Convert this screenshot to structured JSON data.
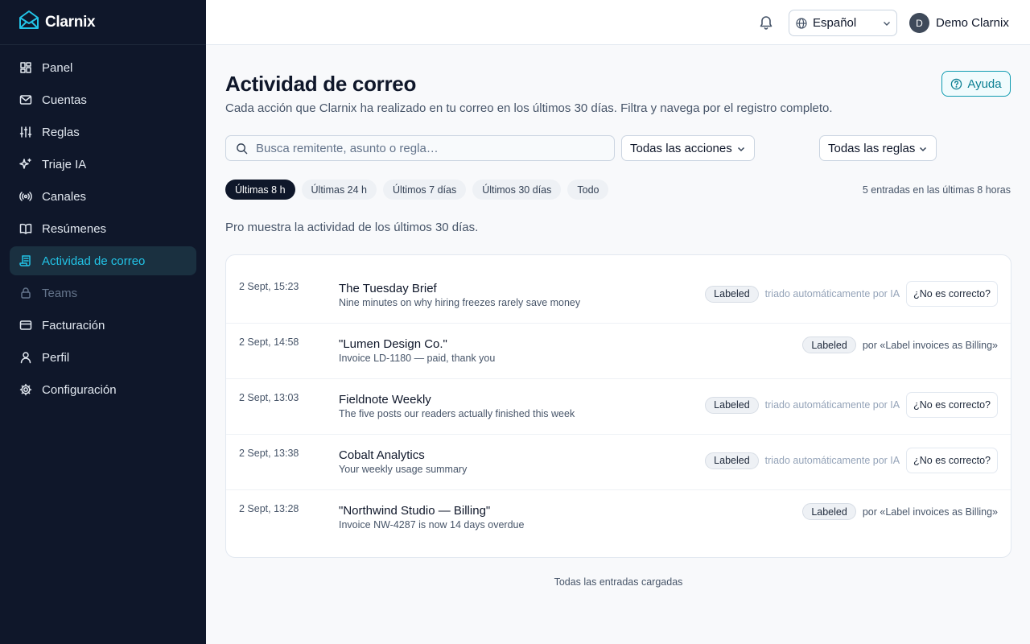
{
  "brand": {
    "name": "Clarnix"
  },
  "sidebar": {
    "items": [
      {
        "label": "Panel",
        "icon": "dashboard-icon"
      },
      {
        "label": "Cuentas",
        "icon": "mail-icon"
      },
      {
        "label": "Reglas",
        "icon": "sliders-icon"
      },
      {
        "label": "Triaje IA",
        "icon": "sparkles-icon"
      },
      {
        "label": "Canales",
        "icon": "broadcast-icon"
      },
      {
        "label": "Resúmenes",
        "icon": "book-icon"
      },
      {
        "label": "Actividad de correo",
        "icon": "scroll-icon",
        "active": true
      },
      {
        "label": "Teams",
        "icon": "lock-icon",
        "disabled": true
      },
      {
        "label": "Facturación",
        "icon": "credit-card-icon"
      },
      {
        "label": "Perfil",
        "icon": "user-icon"
      },
      {
        "label": "Configuración",
        "icon": "gear-icon"
      }
    ]
  },
  "header": {
    "language": "Español",
    "user_initial": "D",
    "user_name": "Demo Clarnix"
  },
  "main": {
    "title": "Actividad de correo",
    "subtitle": "Cada acción que Clarnix ha realizado en tu correo en los últimos 30 días. Filtra y navega por el registro completo.",
    "help_label": "Ayuda",
    "search_placeholder": "Busca remitente, asunto o regla…",
    "actions_filter": "Todas las acciones",
    "rules_filter": "Todas las reglas",
    "time_chips": [
      "Últimas 8 h",
      "Últimas 24 h",
      "Últimos 7 días",
      "Últimos 30 días",
      "Todo"
    ],
    "active_chip": 0,
    "entries_count": "5 entradas en las últimas 8 horas",
    "pro_note": "Pro muestra la actividad de los últimos 30 días.",
    "footer_note": "Todas las entradas cargadas"
  },
  "activity": [
    {
      "time": "2 Sept, 15:23",
      "title": "The Tuesday Brief",
      "subtitle": "Nine minutes on why hiring freezes rarely save money",
      "badge": "Labeled",
      "by": "triado automáticamente por IA",
      "by_rule": false,
      "action": "¿No es correcto?"
    },
    {
      "time": "2 Sept, 14:58",
      "title": "\"Lumen Design Co.\"",
      "subtitle": "Invoice LD-1180 — paid, thank you",
      "badge": "Labeled",
      "by": "por «Label invoices as Billing»",
      "by_rule": true,
      "action": ""
    },
    {
      "time": "2 Sept, 13:03",
      "title": "Fieldnote Weekly",
      "subtitle": "The five posts our readers actually finished this week",
      "badge": "Labeled",
      "by": "triado automáticamente por IA",
      "by_rule": false,
      "action": "¿No es correcto?"
    },
    {
      "time": "2 Sept, 13:38",
      "title": "Cobalt Analytics",
      "subtitle": "Your weekly usage summary",
      "badge": "Labeled",
      "by": "triado automáticamente por IA",
      "by_rule": false,
      "action": "¿No es correcto?"
    },
    {
      "time": "2 Sept, 13:28",
      "title": "\"Northwind Studio — Billing\"",
      "subtitle": "Invoice NW-4287 is now 14 days overdue",
      "badge": "Labeled",
      "by": "por «Label invoices as Billing»",
      "by_rule": true,
      "action": ""
    }
  ]
}
